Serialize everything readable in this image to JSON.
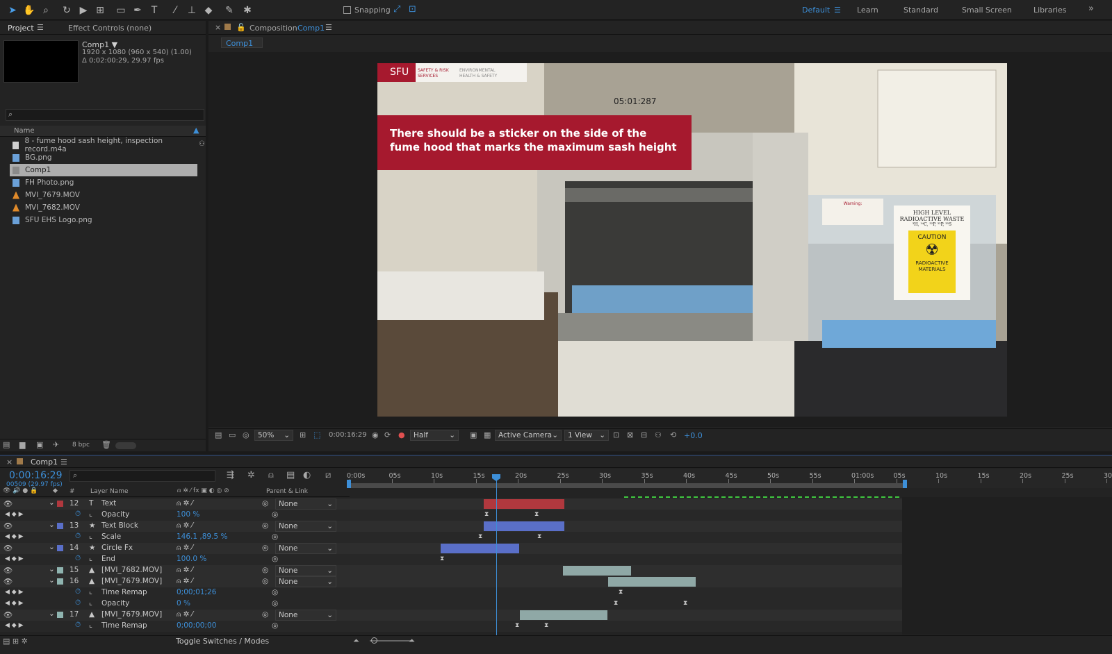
{
  "toolbar": {
    "snapping": "Snapping",
    "workspaces": [
      "Default",
      "Learn",
      "Standard",
      "Small Screen",
      "Libraries"
    ]
  },
  "project": {
    "tab": "Project",
    "effect_tab": "Effect Controls (none)",
    "comp_name": "Comp1 ▼",
    "comp_res": "1920 x 1080  (960 x 540) (1.00)",
    "comp_dur": "Δ 0;02:00:29, 29.97 fps",
    "col_name": "Name",
    "bpc": "8 bpc",
    "files": [
      {
        "name": "8 - fume hood sash height, inspection record.m4a",
        "type": "audio"
      },
      {
        "name": "BG.png",
        "type": "image"
      },
      {
        "name": "Comp1",
        "type": "comp"
      },
      {
        "name": "FH Photo.png",
        "type": "image"
      },
      {
        "name": "MVI_7679.MOV",
        "type": "video"
      },
      {
        "name": "MVI_7682.MOV",
        "type": "video"
      },
      {
        "name": "SFU EHS Logo.png",
        "type": "image"
      }
    ]
  },
  "composition": {
    "tab_prefix": "Composition",
    "tab_name": "Comp1",
    "crumb": "Comp1"
  },
  "frame": {
    "logo": "SFU",
    "logo_sub1": "SAFETY & RISK",
    "logo_sub2": "SERVICES",
    "logo_sub3": "ENVIRONMENTAL",
    "logo_sub4": "HEALTH & SAFETY",
    "timer": "05:01:287",
    "caption": "There should be a sticker on the side of the fume hood that marks the maximum sash height",
    "sign_title": "HIGH LEVEL RADIOACTIVE WASTE",
    "sign_elements": "³H, ¹⁴C, ³²P, ³³P, ³⁵S",
    "caution": "CAUTION",
    "sign_body": "RADIOACTIVE MATERIALS",
    "warn": "Warning:"
  },
  "viewer_bar": {
    "zoom": "50%",
    "time": "0:00:16:29",
    "res": "Half",
    "camera": "Active Camera",
    "views": "1 View",
    "exposure": "+0.0"
  },
  "timeline": {
    "tab": "Comp1",
    "time": "0:00:16:29",
    "frames": "00509 (29.97 fps)",
    "col_layer": "Layer Name",
    "col_parent": "Parent & Link",
    "toggle": "Toggle Switches / Modes",
    "ruler": [
      "0:00s",
      "05s",
      "10s",
      "15s",
      "20s",
      "25s",
      "30s",
      "35s",
      "40s",
      "45s",
      "50s",
      "55s",
      "01:00s",
      "05s",
      "10s",
      "15s",
      "20s",
      "25s",
      "30"
    ],
    "layers": [
      {
        "num": "12",
        "name": "Text",
        "icon": "T",
        "color": "#b0383e",
        "parent": "None"
      },
      {
        "prop": "Opacity",
        "value": "100 %"
      },
      {
        "num": "13",
        "name": "Text Block",
        "icon": "★",
        "color": "#5a6fc8",
        "parent": "None"
      },
      {
        "prop": "Scale",
        "value": "146.1 ,89.5 %"
      },
      {
        "num": "14",
        "name": "Circle Fx",
        "icon": "★",
        "color": "#5a6fc8",
        "parent": "None"
      },
      {
        "prop": "End",
        "value": "100.0 %"
      },
      {
        "num": "15",
        "name": "[MVI_7682.MOV]",
        "icon": "▲",
        "color": "#8fb4b0",
        "parent": "None"
      },
      {
        "num": "16",
        "name": "[MVI_7679.MOV]",
        "icon": "▲",
        "color": "#8fb4b0",
        "parent": "None"
      },
      {
        "prop": "Time Remap",
        "value": "0;00;01;26"
      },
      {
        "prop": "Opacity",
        "value": "0 %"
      },
      {
        "num": "17",
        "name": "[MVI_7679.MOV]",
        "icon": "▲",
        "color": "#8fb4b0",
        "parent": "None"
      },
      {
        "prop": "Time Remap",
        "value": "0;00;00;00"
      }
    ]
  }
}
